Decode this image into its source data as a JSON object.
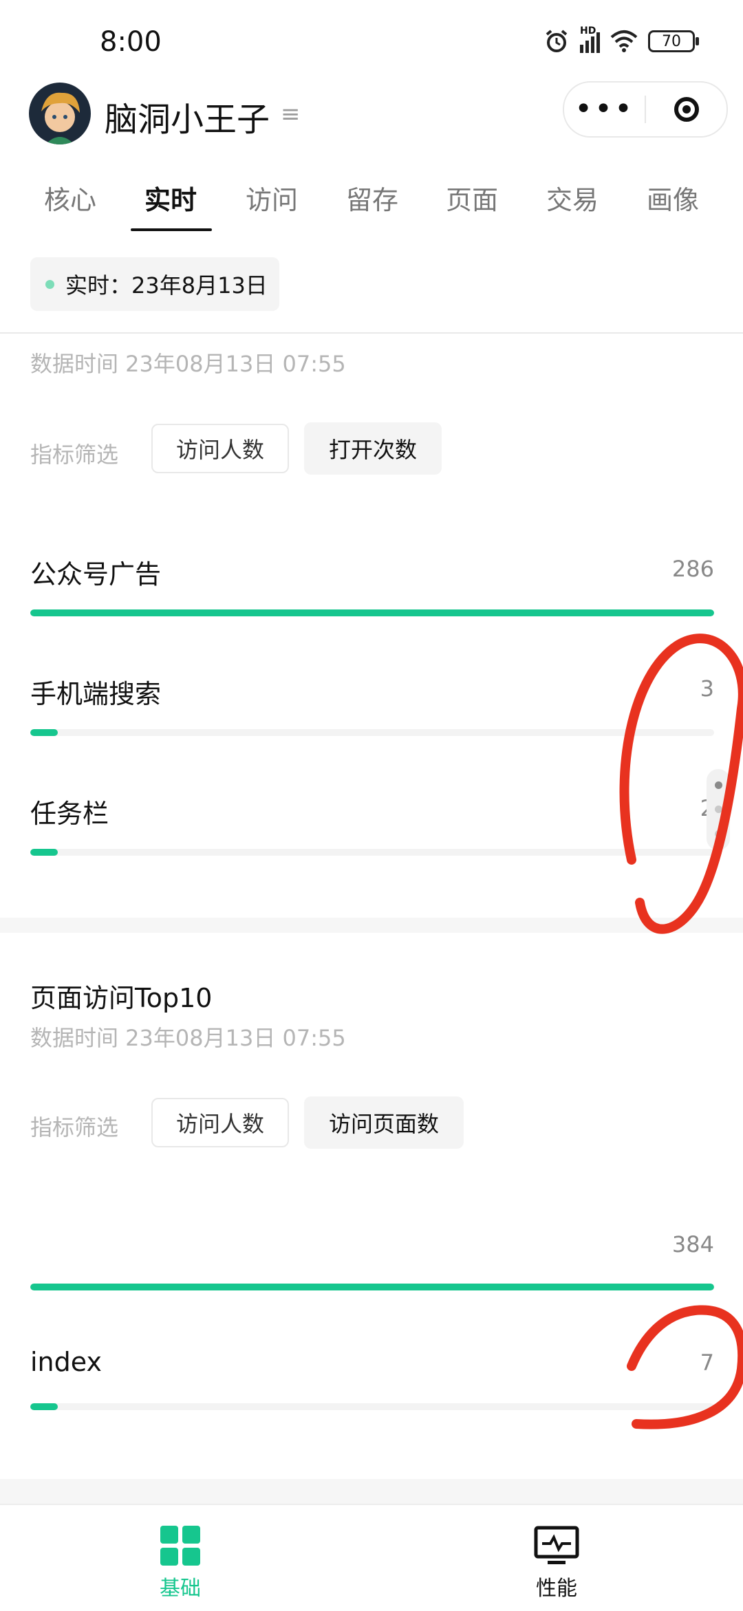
{
  "status_bar": {
    "time": "8:00",
    "battery": "70",
    "network_label": "HD"
  },
  "header": {
    "title": "脑洞小王子",
    "menu_glyph": "≡",
    "more_icon": "more-dots-icon",
    "target_icon": "target-icon"
  },
  "tabs": [
    {
      "label": "核心",
      "active": false
    },
    {
      "label": "实时",
      "active": true
    },
    {
      "label": "访问",
      "active": false
    },
    {
      "label": "留存",
      "active": false
    },
    {
      "label": "页面",
      "active": false
    },
    {
      "label": "交易",
      "active": false
    },
    {
      "label": "画像",
      "active": false
    }
  ],
  "date_chip": {
    "text": "实时：23年8月13日"
  },
  "section1": {
    "data_time": "数据时间 23年08月13日 07:55",
    "filter_label": "指标筛选",
    "filters": [
      "访问人数",
      "打开次数"
    ],
    "rows": [
      {
        "label": "公众号广告",
        "value": "286",
        "fill_fraction": 1.0
      },
      {
        "label": "手机端搜索",
        "value": "3",
        "fill_fraction": 0.04
      },
      {
        "label": "任务栏",
        "value": "2",
        "fill_fraction": 0.04
      }
    ]
  },
  "section2": {
    "title": "页面访问Top10",
    "data_time": "数据时间 23年08月13日 07:55",
    "filter_label": "指标筛选",
    "filters": [
      "访问人数",
      "访问页面数"
    ],
    "rows": [
      {
        "label": "",
        "value": "384",
        "fill_fraction": 1.0
      },
      {
        "label": "index",
        "value": "7",
        "fill_fraction": 0.04
      }
    ]
  },
  "bottom_nav": [
    {
      "label": "基础",
      "icon": "grid-icon",
      "active": true
    },
    {
      "label": "性能",
      "icon": "monitor-pulse-icon",
      "active": false
    }
  ],
  "colors": {
    "accent": "#16c68e",
    "annotation": "#e8321f"
  }
}
